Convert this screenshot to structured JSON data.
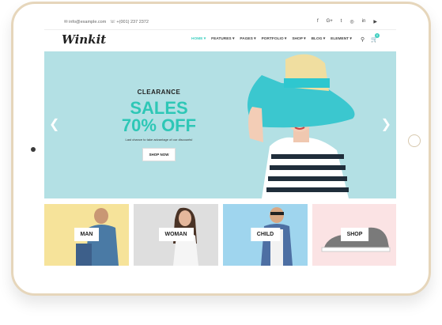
{
  "topbar": {
    "email": "info@example.com",
    "phone": "+(001) 237 2372",
    "social": [
      "f",
      "G+",
      "t",
      "◎",
      "in",
      "▶"
    ]
  },
  "header": {
    "logo": "Winkit",
    "nav": [
      "HOME ▾",
      "FEATURES ▾",
      "PAGES ▾",
      "PORTFOLIO ▾",
      "SHOP ▾",
      "BLOG ▾",
      "ELEMENT ▾"
    ],
    "cart_count": "0"
  },
  "hero": {
    "clearance": "CLEARANCE",
    "sales": "SALES",
    "percent": "70% OFF",
    "tagline": "Last chance to take advantage of our discounts!",
    "button": "SHOP NOW"
  },
  "categories": [
    "MAN",
    "WOMAN",
    "CHILD",
    "SHOP"
  ],
  "colors": {
    "accent": "#2ec7b6",
    "hero_bg": "#b3e0e4",
    "tablet_frame": "#e6d6bb"
  }
}
